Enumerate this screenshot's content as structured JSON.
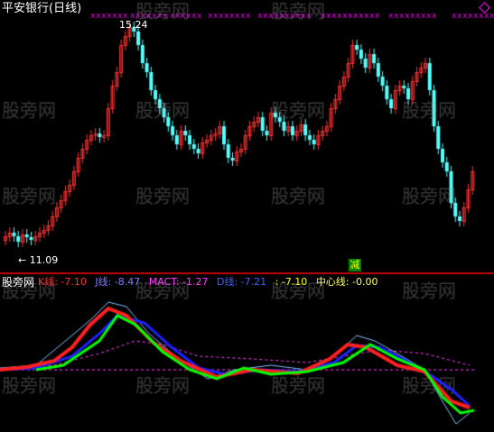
{
  "header": {
    "title": "平安银行(日线)",
    "high_label": "15.24",
    "low_label": "11.09",
    "signal_label": "减"
  },
  "indicator": {
    "name": "股旁网",
    "k_label": "K线: -7.10",
    "j_label": "J线: -8.47",
    "macd_label": "MACT: -1.27",
    "d_label": "D线: -7.21",
    "extra_label": ": -7.10",
    "center_label": "中心线: -0.00"
  },
  "watermark": "股旁网",
  "colors": {
    "up": "#ff3232",
    "down": "#54ffff",
    "divider": "#c00000",
    "k": "#ff2020",
    "j": "#00ff00",
    "d": "#2020ff",
    "macd": "#ff00ff",
    "envelope": "#80c0ff",
    "center": "#ff40ff"
  }
}
